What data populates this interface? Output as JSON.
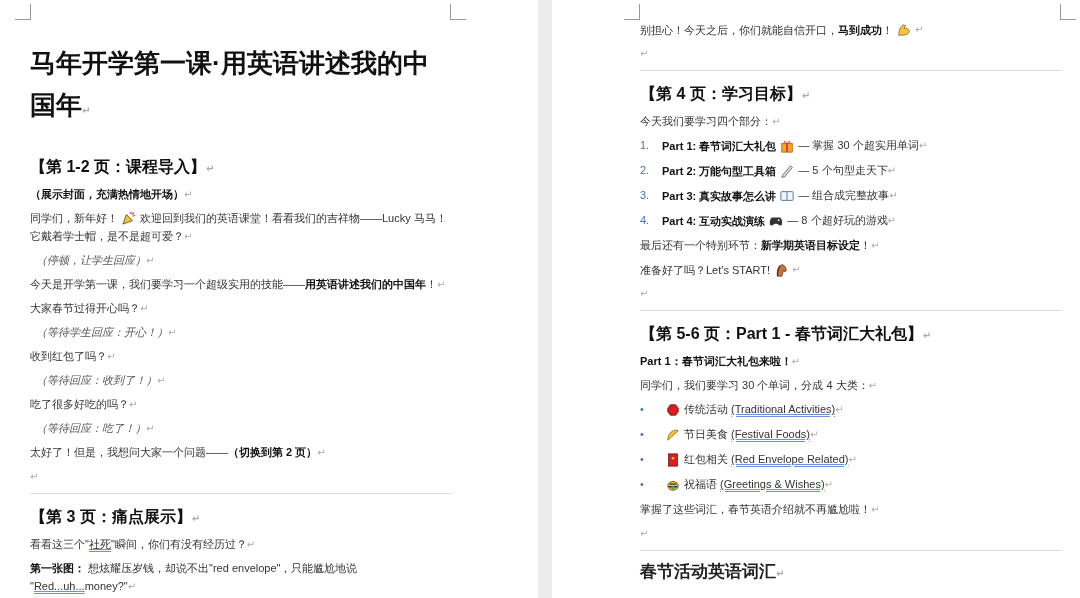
{
  "pages": [
    {
      "blocks": [
        {
          "kind": "title",
          "runs": [
            {
              "text": "马年开学第一课·用英语讲述我的中国年"
            },
            {
              "text": "↵",
              "kind": "mark"
            }
          ]
        },
        {
          "kind": "heading",
          "runs": [
            {
              "text": "【第 1-2 页：课程导入】"
            },
            {
              "text": "↵",
              "kind": "mark"
            }
          ]
        },
        {
          "kind": "para",
          "runs": [
            {
              "text": "（展示封面，充满热情地开场）",
              "kind": "bold"
            },
            {
              "text": "↵",
              "kind": "mark"
            }
          ]
        },
        {
          "kind": "iconpara",
          "lead": [
            {
              "text": "同学们，新年好！"
            }
          ],
          "trail": [
            {
              "text": "欢迎回到我们的英语课堂！看看我们的吉祥物——Lucky 马马！"
            }
          ],
          "more": [
            {
              "text": "它戴着学士帽，是不是超可爱？"
            },
            {
              "text": "↵",
              "kind": "mark"
            }
          ]
        },
        {
          "kind": "note",
          "runs": [
            {
              "text": "（停顿，让学生回应）"
            },
            {
              "text": "↵",
              "kind": "mark"
            }
          ]
        },
        {
          "kind": "para",
          "runs": [
            {
              "text": "今天是开学第一课，我们要学习一个超级实用的技能——"
            },
            {
              "text": "用英语讲述我们的中国年",
              "kind": "bold"
            },
            {
              "text": "！"
            },
            {
              "text": "↵",
              "kind": "mark"
            }
          ]
        },
        {
          "kind": "para",
          "runs": [
            {
              "text": "大家春节过得开心吗？"
            },
            {
              "text": "↵",
              "kind": "mark"
            }
          ]
        },
        {
          "kind": "note",
          "runs": [
            {
              "text": "（等待学生回应：开心！）"
            },
            {
              "text": "↵",
              "kind": "mark"
            }
          ]
        },
        {
          "kind": "para",
          "runs": [
            {
              "text": "收到红包了吗？"
            },
            {
              "text": "↵",
              "kind": "mark"
            }
          ]
        },
        {
          "kind": "note",
          "runs": [
            {
              "text": "（等待回应：收到了！）"
            },
            {
              "text": "↵",
              "kind": "mark"
            }
          ]
        },
        {
          "kind": "para",
          "runs": [
            {
              "text": "吃了很多好吃的吗？"
            },
            {
              "text": "↵",
              "kind": "mark"
            }
          ]
        },
        {
          "kind": "note",
          "runs": [
            {
              "text": "（等待回应：吃了！）"
            },
            {
              "text": "↵",
              "kind": "mark"
            }
          ]
        },
        {
          "kind": "para",
          "runs": [
            {
              "text": "太好了！但是，我想问大家一个问题——"
            },
            {
              "text": "（切换到第 2 页）",
              "kind": "bold"
            },
            {
              "text": "↵",
              "kind": "mark"
            }
          ]
        },
        {
          "kind": "para",
          "runs": [
            {
              "text": "↵",
              "kind": "mark"
            }
          ]
        },
        {
          "kind": "rule"
        },
        {
          "kind": "heading",
          "runs": [
            {
              "text": "【第 3 页：痛点展示】"
            },
            {
              "text": "↵",
              "kind": "mark"
            }
          ]
        },
        {
          "kind": "para",
          "runs": [
            {
              "text": "看看这三个\""
            },
            {
              "text": "社死",
              "kind": "flag"
            },
            {
              "text": "\"瞬间，你们有没有经历过？"
            },
            {
              "text": "↵",
              "kind": "mark"
            }
          ]
        },
        {
          "kind": "para",
          "runs": [
            {
              "text": "第一张图：",
              "kind": "bold"
            },
            {
              "text": " 想炫耀压岁钱，却说不出\"red envelope\"，只能尴尬地说 \""
            },
            {
              "text": "Red...uh...",
              "kind": "flag"
            },
            {
              "text": "money?\""
            },
            {
              "text": "↵",
              "kind": "mark"
            }
          ]
        }
      ]
    },
    {
      "blocks": [
        {
          "kind": "iconpara",
          "lead": [
            {
              "text": "别担心！今天之后，你们就能自信开口，"
            },
            {
              "text": "马到成功",
              "kind": "bold"
            },
            {
              "text": "！"
            }
          ],
          "trail": [
            {
              "text": "↵",
              "kind": "mark"
            }
          ]
        },
        {
          "kind": "para",
          "runs": [
            {
              "text": "↵",
              "kind": "mark"
            }
          ]
        },
        {
          "kind": "rule"
        },
        {
          "kind": "heading",
          "runs": [
            {
              "text": "【第 4 页：学习目标】"
            },
            {
              "text": "↵",
              "kind": "mark"
            }
          ]
        },
        {
          "kind": "para",
          "runs": [
            {
              "text": "今天我们要学习四个部分："
            },
            {
              "text": "↵",
              "kind": "mark"
            }
          ]
        },
        {
          "kind": "item",
          "marker": "1.",
          "lead": [
            {
              "text": "Part 1: 春节词汇大礼包",
              "kind": "bold"
            }
          ],
          "trail": [
            {
              "text": " — 掌握 30 个超实用单词"
            },
            {
              "text": "↵",
              "kind": "mark"
            }
          ]
        },
        {
          "kind": "item",
          "marker": "2.",
          "lead": [
            {
              "text": "Part 2: 万能句型工具箱",
              "kind": "bold"
            }
          ],
          "trail": [
            {
              "text": " — 5 个句型走天下"
            },
            {
              "text": "↵",
              "kind": "mark"
            }
          ]
        },
        {
          "kind": "item",
          "marker": "3.",
          "lead": [
            {
              "text": "Part 3: 真实故事怎么讲",
              "kind": "bold"
            }
          ],
          "trail": [
            {
              "text": " — 组合成完整故事"
            },
            {
              "text": "↵",
              "kind": "mark"
            }
          ]
        },
        {
          "kind": "item",
          "marker": "4.",
          "lead": [
            {
              "text": "Part 4: 互动实战演练",
              "kind": "bold"
            }
          ],
          "trail": [
            {
              "text": " — 8 个超好玩的游戏"
            },
            {
              "text": "↵",
              "kind": "mark"
            }
          ]
        },
        {
          "kind": "para",
          "runs": [
            {
              "text": "最后还有一个特别环节："
            },
            {
              "text": "新学期英语目标设定",
              "kind": "bold"
            },
            {
              "text": "！"
            },
            {
              "text": "↵",
              "kind": "mark"
            }
          ]
        },
        {
          "kind": "iconpara",
          "lead": [
            {
              "text": "准备好了吗？Let's START!"
            }
          ],
          "trail": [
            {
              "text": "↵",
              "kind": "mark"
            }
          ]
        },
        {
          "kind": "para",
          "runs": [
            {
              "text": "↵",
              "kind": "mark"
            }
          ]
        },
        {
          "kind": "rule"
        },
        {
          "kind": "heading",
          "runs": [
            {
              "text": "【第 5-6 页：Part 1 - 春节词汇大礼包】"
            },
            {
              "text": "↵",
              "kind": "mark"
            }
          ]
        },
        {
          "kind": "para",
          "runs": [
            {
              "text": "Part 1：春节词汇大礼包来啦！",
              "kind": "bold"
            },
            {
              "text": "↵",
              "kind": "mark"
            }
          ]
        },
        {
          "kind": "para",
          "runs": [
            {
              "text": "同学们，我们要学习 30 个单词，分成 4 大类："
            },
            {
              "text": "↵",
              "kind": "mark"
            }
          ]
        },
        {
          "kind": "item",
          "marker": "•",
          "trail": [
            {
              "text": "传统活动 "
            },
            {
              "text": "(Traditional Activities)",
              "kind": "flag"
            },
            {
              "text": "↵",
              "kind": "mark"
            }
          ]
        },
        {
          "kind": "item",
          "marker": "•",
          "trail": [
            {
              "text": "节日美食 "
            },
            {
              "text": "(Festival Foods)",
              "kind": "flag"
            },
            {
              "text": "↵",
              "kind": "mark"
            }
          ]
        },
        {
          "kind": "item",
          "marker": "•",
          "trail": [
            {
              "text": "红包相关 "
            },
            {
              "text": "(Red Envelope Related)",
              "kind": "flag"
            },
            {
              "text": "↵",
              "kind": "mark"
            }
          ]
        },
        {
          "kind": "item",
          "marker": "•",
          "trail": [
            {
              "text": "祝福语 "
            },
            {
              "text": "(Greetings & Wishes)",
              "kind": "flag"
            },
            {
              "text": "↵",
              "kind": "mark"
            }
          ]
        },
        {
          "kind": "para",
          "runs": [
            {
              "text": "掌握了这些词汇，春节英语介绍就不再尴尬啦！"
            },
            {
              "text": "↵",
              "kind": "mark"
            }
          ]
        },
        {
          "kind": "para",
          "runs": [
            {
              "text": "↵",
              "kind": "mark"
            }
          ]
        },
        {
          "kind": "rule"
        },
        {
          "kind": "subheading",
          "runs": [
            {
              "text": "春节活动英语词汇"
            },
            {
              "text": "↵",
              "kind": "mark"
            }
          ]
        }
      ]
    }
  ]
}
